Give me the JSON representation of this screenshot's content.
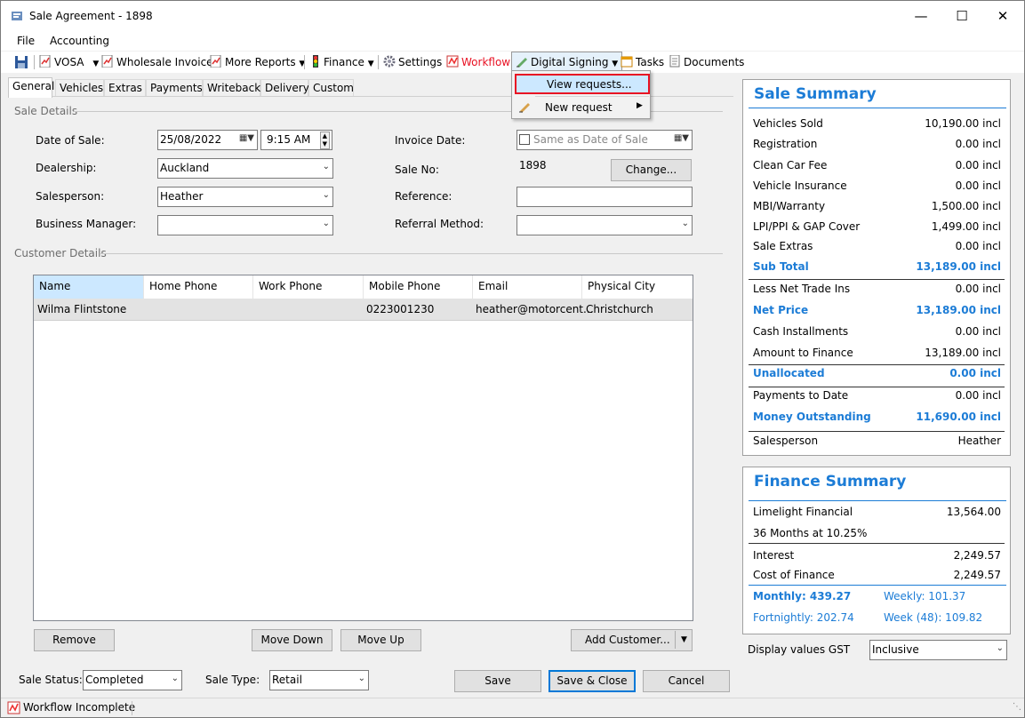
{
  "window": {
    "title": "Sale Agreement - 1898"
  },
  "menu": [
    "File",
    "Accounting"
  ],
  "toolbar": {
    "vosa": "VOSA",
    "wholesale_invoice": "Wholesale Invoice",
    "more_reports": "More Reports",
    "finance": "Finance",
    "settings": "Settings",
    "workflow": "Workflow",
    "digital_signing": "Digital Signing",
    "tasks": "Tasks",
    "documents": "Documents"
  },
  "dropdown": {
    "view_requests": "View requests...",
    "new_request": "New request"
  },
  "tabs": [
    "General",
    "Vehicles",
    "Extras",
    "Payments",
    "Writeback",
    "Delivery",
    "Custom"
  ],
  "sale_details": {
    "group_label": "Sale Details",
    "date_of_sale_label": "Date of Sale:",
    "date_of_sale": "25/08/2022",
    "time": "9:15 AM",
    "dealership_label": "Dealership:",
    "dealership": "Auckland",
    "salesperson_label": "Salesperson:",
    "salesperson": "Heather",
    "business_manager_label": "Business Manager:",
    "business_manager": "",
    "invoice_date_label": "Invoice Date:",
    "same_as_date": "Same as Date of Sale",
    "sale_no_label": "Sale No:",
    "sale_no": "1898",
    "change_button": "Change...",
    "reference_label": "Reference:",
    "reference": "",
    "referral_method_label": "Referral Method:",
    "referral_method": ""
  },
  "customer_details": {
    "group_label": "Customer Details",
    "columns": [
      "Name",
      "Home Phone",
      "Work Phone",
      "Mobile Phone",
      "Email",
      "Physical City"
    ],
    "rows": [
      {
        "name": "Wilma Flintstone",
        "home": "",
        "work": "",
        "mobile": "0223001230",
        "email": "heather@motorcent...",
        "city": "Christchurch"
      }
    ],
    "remove": "Remove",
    "move_down": "Move Down",
    "move_up": "Move Up",
    "add_customer": "Add Customer..."
  },
  "footer": {
    "sale_status_label": "Sale Status:",
    "sale_status": "Completed",
    "sale_type_label": "Sale Type:",
    "sale_type": "Retail",
    "save": "Save",
    "save_close": "Save & Close",
    "cancel": "Cancel"
  },
  "sale_summary": {
    "title": "Sale Summary",
    "rows": [
      {
        "label": "Vehicles Sold",
        "value": "10,190.00 incl"
      },
      {
        "label": "Registration",
        "value": "0.00 incl"
      },
      {
        "label": "Clean Car Fee",
        "value": "0.00 incl"
      },
      {
        "label": "Vehicle Insurance",
        "value": "0.00 incl"
      },
      {
        "label": "MBI/Warranty",
        "value": "1,500.00 incl"
      },
      {
        "label": "LPI/PPI & GAP Cover",
        "value": "1,499.00 incl"
      },
      {
        "label": "Sale Extras",
        "value": "0.00 incl"
      },
      {
        "label": "Sub Total",
        "value": "13,189.00 incl"
      },
      {
        "label": "Less Net Trade Ins",
        "value": "0.00 incl"
      },
      {
        "label": "Net Price",
        "value": "13,189.00 incl"
      },
      {
        "label": "Cash Installments",
        "value": "0.00 incl"
      },
      {
        "label": "Amount to Finance",
        "value": "13,189.00 incl"
      },
      {
        "label": "Unallocated",
        "value": "0.00 incl"
      },
      {
        "label": "Payments to Date",
        "value": "0.00 incl"
      },
      {
        "label": "Money Outstanding",
        "value": "11,690.00 incl"
      },
      {
        "label": "Salesperson",
        "value": "Heather"
      }
    ]
  },
  "finance_summary": {
    "title": "Finance Summary",
    "lender": "Limelight Financial",
    "amount": "13,564.00",
    "term": "36 Months at 10.25%",
    "interest_label": "Interest",
    "interest": "2,249.57",
    "cost_label": "Cost of Finance",
    "cost": "2,249.57",
    "monthly": "Monthly: 439.27",
    "weekly": "Weekly: 101.37",
    "fortnightly": "Fortnightly: 202.74",
    "week48": "Week (48): 109.82"
  },
  "gst": {
    "label": "Display values GST",
    "value": "Inclusive"
  },
  "status": {
    "text": "Workflow Incomplete"
  },
  "colors": {
    "accent": "#1c7cd6",
    "highlight": "#e81123",
    "selection": "#cce8ff"
  }
}
